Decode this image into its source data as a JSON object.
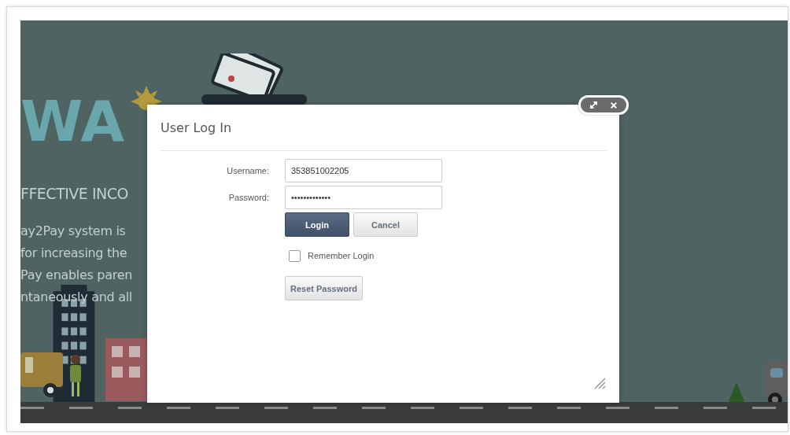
{
  "background_page": {
    "logo_text": "WA",
    "heading": "FFECTIVE INCO",
    "paragraph_lines": [
      "ay2Pay system is",
      "for increasing the",
      "Pay enables paren",
      "ntaneously and all"
    ]
  },
  "dialog": {
    "title": "User Log In",
    "fields": [
      {
        "label": "Username:",
        "value": "353851002205"
      },
      {
        "label": "Password:",
        "value": "•••••••••••••"
      }
    ],
    "buttons": [
      {
        "label": "Login",
        "kind": "primary"
      },
      {
        "label": "Cancel",
        "kind": "secondary"
      }
    ],
    "remember": {
      "label": "Remember Login",
      "checked": false
    },
    "reset_button": "Reset Password"
  }
}
